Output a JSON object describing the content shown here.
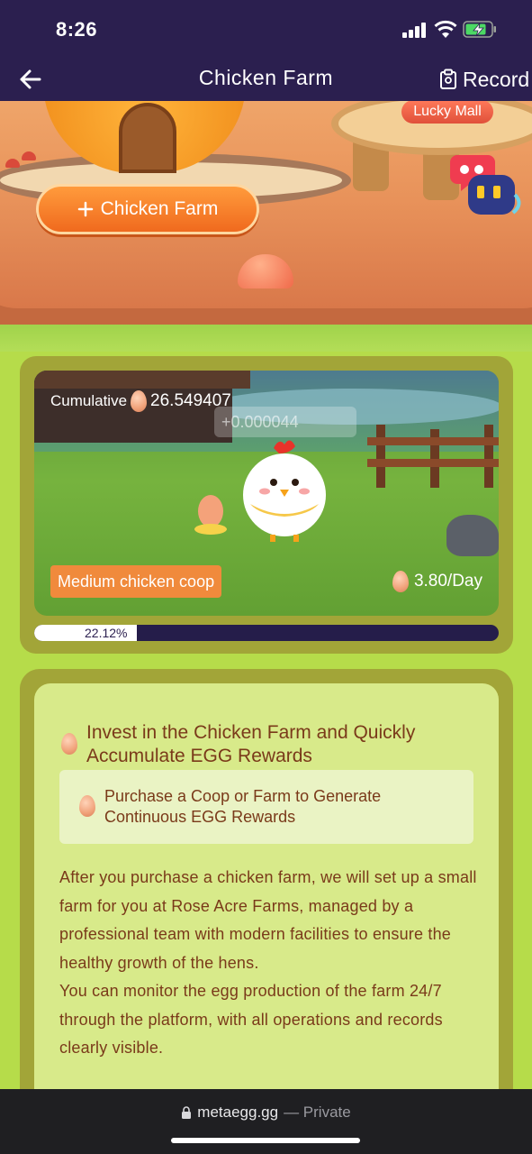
{
  "status_bar": {
    "time": "8:26"
  },
  "header": {
    "title": "Chicken Farm",
    "record_label": "Record"
  },
  "scene": {
    "lucky_mall_label": "Lucky Mall",
    "add_farm_label": "Chicken Farm",
    "add_farm_icon": "plus-icon"
  },
  "coop": {
    "cumulative_label": "Cumulative",
    "cumulative_value": "26.549407",
    "delta_value": "+0.000044",
    "coop_type": "Medium chicken coop",
    "rate": "3.80/Day",
    "progress_label": "22.12%",
    "progress_fraction": 0.2212
  },
  "info": {
    "heading": "Invest in the Chicken Farm and Quickly Accumulate EGG Rewards",
    "subheading": "Purchase a Coop or Farm to Generate Continuous EGG Rewards",
    "paragraph1": "After you purchase a chicken farm, we will set up a small farm for you at Rose Acre Farms, managed by a professional team with modern facilities to ensure the healthy growth of the hens.",
    "paragraph2": "You can monitor the egg production of the farm 24/7 through the platform, with all operations and records clearly visible."
  },
  "browser": {
    "url": "metaegg.gg",
    "privacy": "— Private"
  },
  "colors": {
    "header_bg": "#2b1f4f",
    "accent_orange": "#f06a1e",
    "text_brown": "#7a3a1a",
    "card_bg": "#d8ea8a"
  }
}
